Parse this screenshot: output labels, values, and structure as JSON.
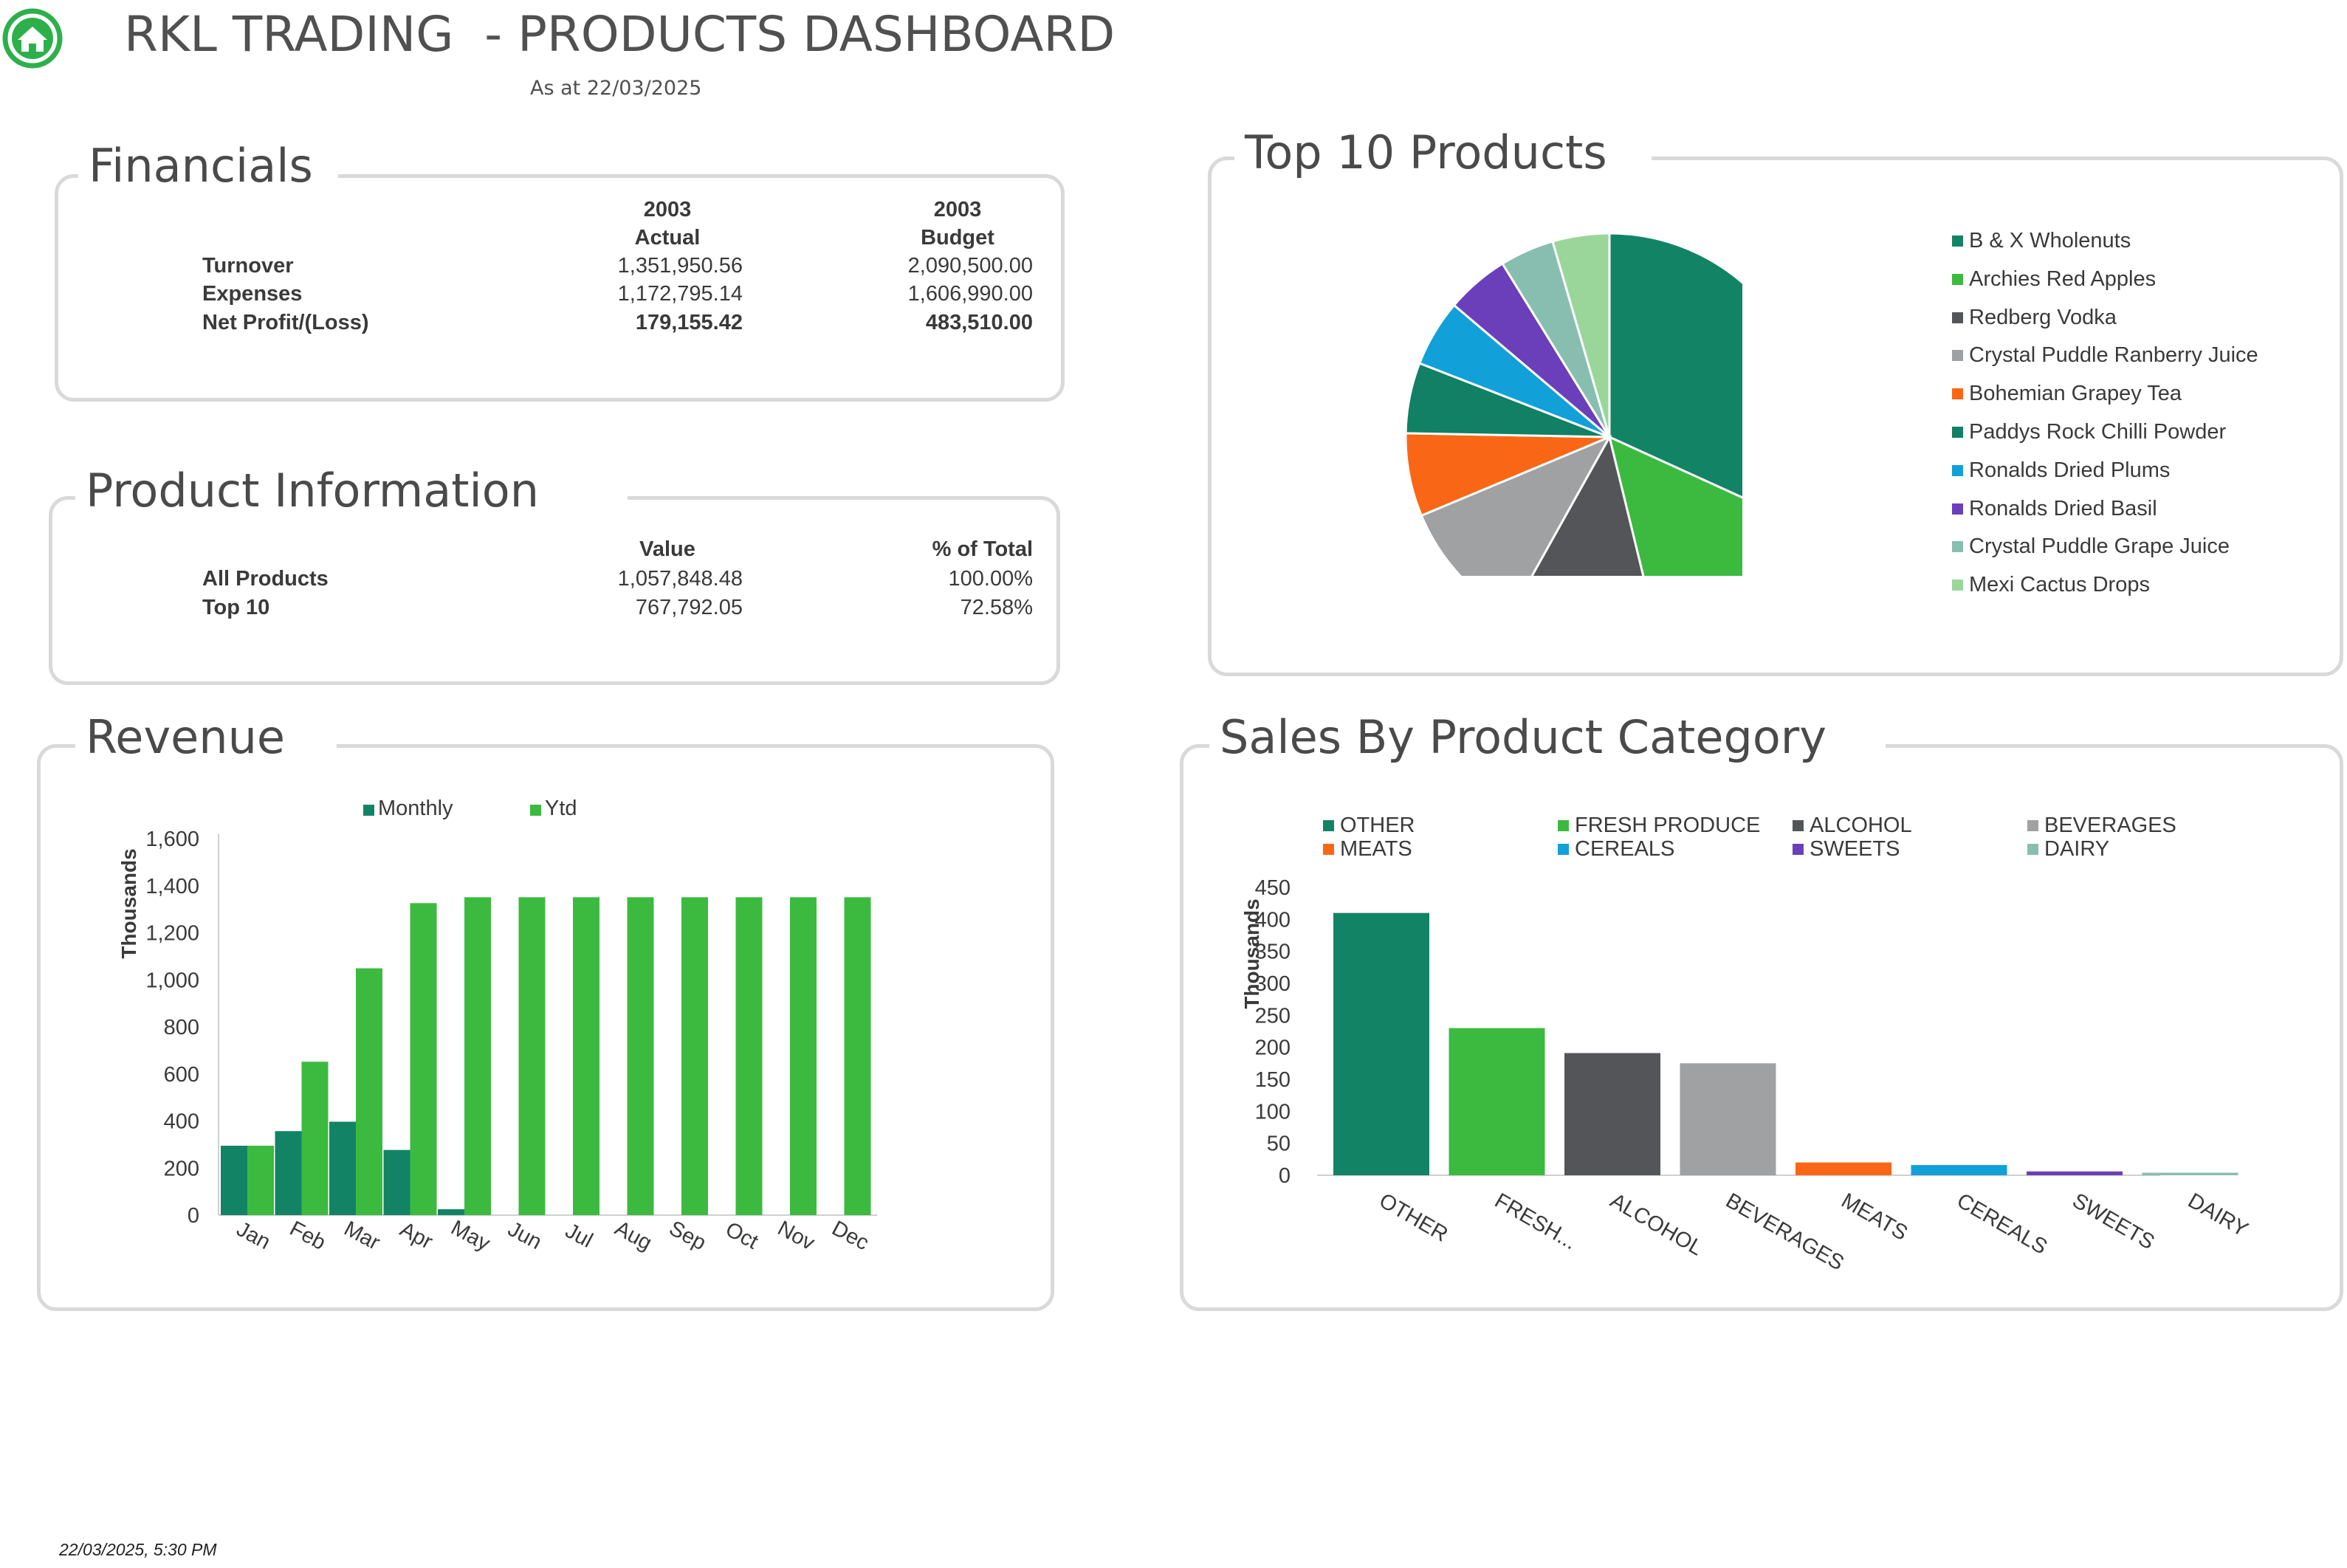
{
  "header": {
    "title": "RKL TRADING  - PRODUCTS DASHBOARD",
    "subtitle": "As at 22/03/2025"
  },
  "financials": {
    "title": "Financials",
    "col1_year": "2003",
    "col1_label": "Actual",
    "col2_year": "2003",
    "col2_label": "Budget",
    "rows": [
      {
        "label": "Turnover",
        "actual": "1,351,950.56",
        "budget": "2,090,500.00"
      },
      {
        "label": "Expenses",
        "actual": "1,172,795.14",
        "budget": "1,606,990.00"
      },
      {
        "label": "Net Profit/(Loss)",
        "actual": "179,155.42",
        "budget": "483,510.00"
      }
    ]
  },
  "product_info": {
    "title": "Product Information",
    "col1_label": "Value",
    "col2_label": "% of Total",
    "rows": [
      {
        "label": "All Products",
        "value": "1,057,848.48",
        "pct": "100.00%"
      },
      {
        "label": "Top 10",
        "value": "767,792.05",
        "pct": "72.58%"
      }
    ]
  },
  "revenue": {
    "title": "Revenue"
  },
  "top10": {
    "title": "Top 10 Products"
  },
  "sales_category": {
    "title": "Sales By Product Category"
  },
  "footer": {
    "timestamp": "22/03/2025, 5:30 PM"
  },
  "colors": {
    "accent_green": "#3cba3f",
    "dark_teal": "#128465",
    "icon_green": "#2db04b"
  },
  "chart_data": [
    {
      "type": "bar",
      "categories": [
        "Jan",
        "Feb",
        "Mar",
        "Apr",
        "May",
        "Jun",
        "Jul",
        "Aug",
        "Sep",
        "Oct",
        "Nov",
        "Dec"
      ],
      "series": [
        {
          "name": "Monthly",
          "color": "#128465",
          "values": [
            295,
            357,
            397,
            277,
            25,
            0,
            0,
            0,
            0,
            0,
            0,
            0
          ]
        },
        {
          "name": "Ytd",
          "color": "#3cba3f",
          "values": [
            295,
            652,
            1049,
            1326,
            1351,
            1351,
            1351,
            1351,
            1351,
            1351,
            1351,
            1351
          ]
        }
      ],
      "ylabel": "Thousands",
      "ylim": [
        0,
        1600
      ],
      "yticks": [
        "0",
        "200",
        "400",
        "600",
        "800",
        "1,000",
        "1,200",
        "1,400",
        "1,600"
      ],
      "legend": "top"
    },
    {
      "type": "pie",
      "labels": [
        "B & X Wholenuts",
        "Archies Red Apples",
        "Redberg Vodka",
        "Crystal Puddle Ranberry Juice",
        "Bohemian Grapey Tea",
        "Paddys Rock Chilli Powder",
        "Ronalds Dried Plums",
        "Ronalds Dried Basil",
        "Crystal Puddle Grape Juice",
        "Mexi Cactus Drops"
      ],
      "values": [
        31.8,
        14.4,
        11.9,
        10.6,
        6.6,
        5.6,
        5.3,
        5.0,
        4.3,
        4.5
      ],
      "colors": [
        "#128465",
        "#3cba3f",
        "#545558",
        "#a0a1a2",
        "#f96716",
        "#118064",
        "#11a0d8",
        "#6b3fba",
        "#88beb0",
        "#9ad69a"
      ],
      "legend": "right"
    },
    {
      "type": "bar",
      "categories": [
        "OTHER",
        "FRESH...",
        "ALCOHOL",
        "BEVERAGES",
        "MEATS",
        "CEREALS",
        "SWEETS",
        "DAIRY"
      ],
      "legend_labels": [
        "OTHER",
        "FRESH PRODUCE",
        "ALCOHOL",
        "BEVERAGES",
        "MEATS",
        "CEREALS",
        "SWEETS",
        "DAIRY"
      ],
      "values": [
        410,
        230,
        191,
        175,
        20,
        16,
        6,
        4
      ],
      "colors": [
        "#128465",
        "#3cba3f",
        "#545558",
        "#a0a1a2",
        "#f96716",
        "#11a0d8",
        "#6b3fba",
        "#88beb0"
      ],
      "ylabel": "Thousands",
      "ylim": [
        0,
        450
      ],
      "yticks": [
        "0",
        "50",
        "100",
        "150",
        "200",
        "250",
        "300",
        "350",
        "400",
        "450"
      ],
      "legend": "top"
    }
  ]
}
